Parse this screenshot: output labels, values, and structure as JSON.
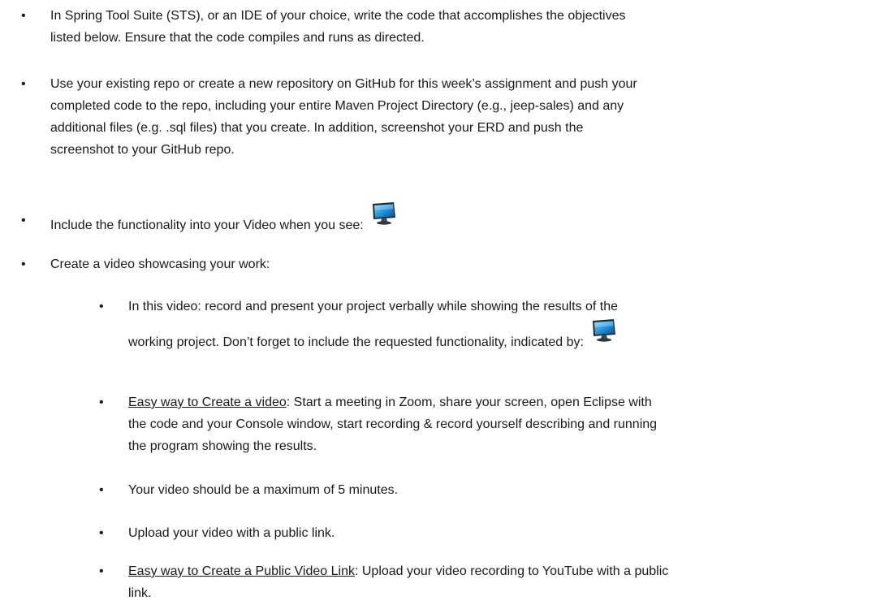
{
  "bullets": {
    "b1": "In Spring Tool Suite (STS), or an IDE of your choice, write the code that accomplishes the objectives listed below. Ensure that the code compiles and runs as directed.",
    "b1_line1": "In Spring Tool Suite (STS), or an IDE of your choice, write the code that accomplishes the objectives",
    "b1_line2": "listed below. Ensure that the code compiles and runs as directed.",
    "b2_line1": "Use your existing repo or create a new repository on GitHub for this week’s assignment and push your",
    "b2_line2": "completed code to the repo, including your entire Maven Project Directory (e.g., jeep-sales) and any",
    "b2_line3": "additional files (e.g. .sql files) that you create.  In addition, screenshot your ERD and push the",
    "b2_line4": "screenshot to your GitHub repo.",
    "b3": "Include the functionality into your Video when you see:",
    "b4": "Create a video showcasing your work:"
  },
  "sub_bullets": {
    "s1_line1": "In this video: record and present your project verbally while showing the results of the",
    "s1_line2": "working project.   Don’t forget to include the requested functionality, indicated by:",
    "s2_link": "Easy way to Create a video",
    "s2_line1_rest": ":  Start a meeting in Zoom, share your screen, open Eclipse with",
    "s2_line2": "the code and your Console window, start recording & record yourself describing and running",
    "s2_line3": "the program showing the results.",
    "s3": "Your video should be a maximum of 5 minutes.",
    "s4": "Upload your video with a public link.",
    "s5_link": "Easy way to Create a Public Video Link",
    "s5_line1_rest": ":  Upload your video recording to YouTube with a public",
    "s5_line2": "link."
  },
  "bullet_char": "•",
  "icons": {
    "video_marker": "monitor-icon"
  }
}
